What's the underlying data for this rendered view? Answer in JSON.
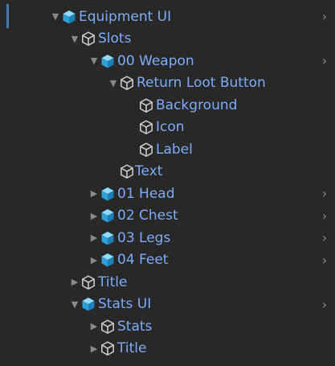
{
  "colors": {
    "background": "#282828",
    "label": "#7cacf8",
    "arrow": "#8a8a8a",
    "prefab_icon": "#3ab5ef",
    "gameobject_icon": "#c8c8c8",
    "selection": "#3a79bb"
  },
  "tree": [
    {
      "label": "Equipment UI",
      "icon": "prefab-cube-icon",
      "fold": "expanded",
      "more": "›"
    },
    {
      "label": "Slots",
      "icon": "gameobject-cube-icon",
      "fold": "expanded"
    },
    {
      "label": "00 Weapon",
      "icon": "prefab-cube-icon",
      "fold": "expanded",
      "more": "›"
    },
    {
      "label": "Return Loot Button",
      "icon": "gameobject-cube-icon",
      "fold": "expanded"
    },
    {
      "label": "Background",
      "icon": "gameobject-cube-icon"
    },
    {
      "label": "Icon",
      "icon": "gameobject-cube-icon"
    },
    {
      "label": "Label",
      "icon": "gameobject-cube-icon"
    },
    {
      "label": "Text",
      "icon": "gameobject-cube-icon"
    },
    {
      "label": "01 Head",
      "icon": "prefab-cube-icon",
      "fold": "collapsed",
      "more": "›"
    },
    {
      "label": "02 Chest",
      "icon": "prefab-cube-icon",
      "fold": "collapsed",
      "more": "›"
    },
    {
      "label": "03 Legs",
      "icon": "prefab-cube-icon",
      "fold": "collapsed",
      "more": "›"
    },
    {
      "label": "04 Feet",
      "icon": "prefab-cube-icon",
      "fold": "collapsed",
      "more": "›"
    },
    {
      "label": "Title",
      "icon": "gameobject-cube-icon",
      "fold": "collapsed"
    },
    {
      "label": "Stats UI",
      "icon": "prefab-cube-icon",
      "fold": "expanded",
      "more": "›"
    },
    {
      "label": "Stats",
      "icon": "gameobject-cube-icon",
      "fold": "collapsed"
    },
    {
      "label": "Title",
      "icon": "gameobject-cube-icon",
      "fold": "collapsed"
    }
  ]
}
